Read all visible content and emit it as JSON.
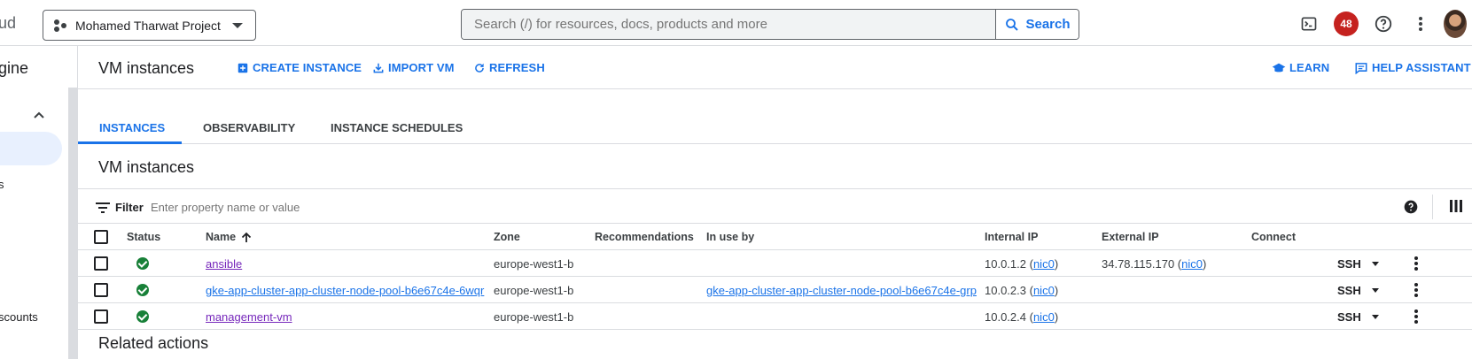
{
  "topbar": {
    "brand_fragment": "ud",
    "project_name": "Mohamed Tharwat Project",
    "search_placeholder": "Search (/) for resources, docs, products and more",
    "search_button": "Search",
    "notification_count": "48",
    "icons": [
      "cloud-shell-icon",
      "notifications-badge",
      "help-icon",
      "more-vert-icon",
      "avatar"
    ]
  },
  "leftnav": {
    "title_fragment": "gine",
    "items": [
      {
        "label": "s"
      },
      {
        "label": "scounts"
      }
    ]
  },
  "header": {
    "title": "VM instances",
    "actions": [
      {
        "label": "CREATE INSTANCE",
        "icon": "add-box-icon"
      },
      {
        "label": "IMPORT VM",
        "icon": "download-icon"
      },
      {
        "label": "REFRESH",
        "icon": "refresh-icon"
      }
    ],
    "right_actions": [
      {
        "label": "LEARN",
        "icon": "school-icon"
      },
      {
        "label": "HELP ASSISTANT",
        "icon": "chat-icon"
      }
    ]
  },
  "tabs": [
    {
      "label": "INSTANCES",
      "active": true
    },
    {
      "label": "OBSERVABILITY",
      "active": false
    },
    {
      "label": "INSTANCE SCHEDULES",
      "active": false
    }
  ],
  "section_title": "VM instances",
  "filter": {
    "label": "Filter",
    "placeholder": "Enter property name or value"
  },
  "table": {
    "columns": {
      "status": "Status",
      "name": "Name",
      "zone": "Zone",
      "recommendations": "Recommendations",
      "in_use_by": "In use by",
      "internal_ip": "Internal IP",
      "external_ip": "External IP",
      "connect": "Connect"
    },
    "sort": "Name ascending",
    "rows": [
      {
        "status": "running",
        "name": "ansible",
        "zone": "europe-west1-b",
        "recommendations": "",
        "in_use_by": "",
        "internal_ip": "10.0.1.2",
        "internal_nic": "nic0",
        "external_ip": "34.78.115.170",
        "external_nic": "nic0",
        "connect": "SSH"
      },
      {
        "status": "running",
        "name": "gke-app-cluster-app-cluster-node-pool-b6e67c4e-6wqr",
        "zone": "europe-west1-b",
        "recommendations": "",
        "in_use_by": "gke-app-cluster-app-cluster-node-pool-b6e67c4e-grp",
        "internal_ip": "10.0.2.3",
        "internal_nic": "nic0",
        "external_ip": "",
        "external_nic": "",
        "connect": "SSH"
      },
      {
        "status": "running",
        "name": "management-vm",
        "zone": "europe-west1-b",
        "recommendations": "",
        "in_use_by": "",
        "internal_ip": "10.0.2.4",
        "internal_nic": "nic0",
        "external_ip": "",
        "external_nic": "",
        "connect": "SSH"
      }
    ]
  },
  "related_actions_title": "Related actions",
  "colors": {
    "accent": "#1a73e8",
    "visited_link": "#7627bb",
    "status_ok": "#188038",
    "badge": "#c5221f"
  }
}
